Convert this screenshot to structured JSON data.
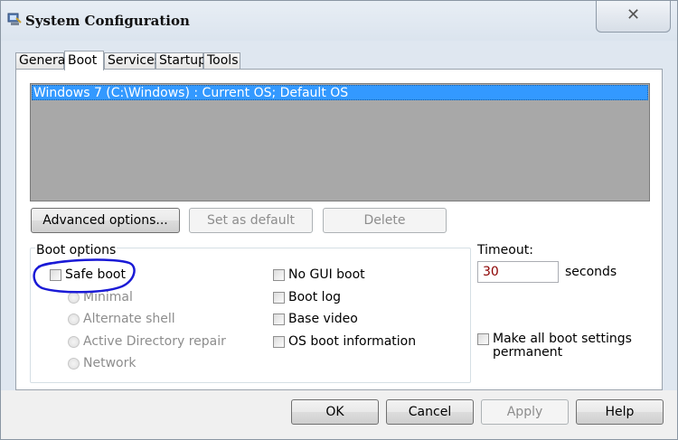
{
  "window": {
    "title": "System Configuration",
    "close_glyph": "✕"
  },
  "tabs": [
    {
      "label": "General"
    },
    {
      "label": "Boot",
      "active": true
    },
    {
      "label": "Services"
    },
    {
      "label": "Startup"
    },
    {
      "label": "Tools"
    }
  ],
  "os_list": {
    "items": [
      {
        "label": "Windows 7 (C:\\Windows) : Current OS; Default OS",
        "selected": true
      }
    ]
  },
  "list_buttons": {
    "advanced": "Advanced options...",
    "set_default": "Set as default",
    "delete": "Delete"
  },
  "boot_options": {
    "label": "Boot options",
    "safe_boot": "Safe boot",
    "safe_boot_checked": false,
    "radios": [
      "Minimal",
      "Alternate shell",
      "Active Directory repair",
      "Network"
    ],
    "checkboxes": [
      "No GUI boot",
      "Boot log",
      "Base video",
      "OS boot information"
    ]
  },
  "timeout": {
    "label": "Timeout:",
    "value": "30",
    "unit": "seconds"
  },
  "permanent": {
    "line1": "Make all boot settings",
    "line2": "permanent",
    "checked": false
  },
  "footer_buttons": {
    "ok": "OK",
    "cancel": "Cancel",
    "apply": "Apply",
    "help": "Help"
  },
  "colors": {
    "selection": "#3399ff",
    "list_bg": "#a8a8a8",
    "annotation": "#1a1ad6",
    "timeout_text": "#8b0000"
  }
}
